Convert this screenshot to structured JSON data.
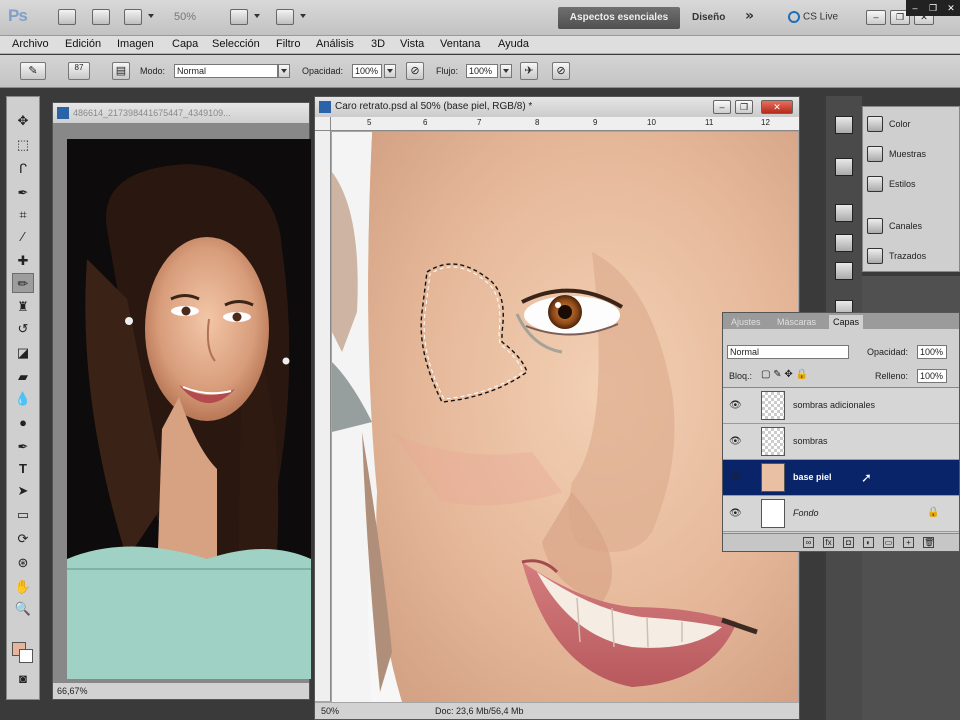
{
  "app": {
    "logo": "Ps",
    "zoom_display": "50%",
    "workspace_active": "Aspectos esenciales",
    "workspace_design": "Diseño",
    "workspace_more": "»",
    "cs_live": "CS Live",
    "window_controls": [
      "–",
      "❐",
      "✕"
    ]
  },
  "menu": [
    "Archivo",
    "Edición",
    "Imagen",
    "Capa",
    "Selección",
    "Filtro",
    "Análisis",
    "3D",
    "Vista",
    "Ventana",
    "Ayuda"
  ],
  "options": {
    "brush_size": "87",
    "mode_label": "Modo:",
    "mode_value": "Normal",
    "opacity_label": "Opacidad:",
    "opacity_value": "100%",
    "flow_label": "Flujo:",
    "flow_value": "100%"
  },
  "tools": [
    "move-tool",
    "marquee-tool",
    "lasso-tool",
    "quick-select-tool",
    "crop-tool",
    "eyedropper-tool",
    "healing-tool",
    "brush-tool",
    "stamp-tool",
    "history-brush-tool",
    "eraser-tool",
    "gradient-tool",
    "blur-tool",
    "dodge-tool",
    "pen-tool",
    "type-tool",
    "path-select-tool",
    "shape-tool",
    "3d-rotate-tool",
    "3d-camera-tool",
    "hand-tool",
    "zoom-tool"
  ],
  "colors": {
    "foreground": "#e7b59b",
    "background": "#ffffff",
    "accent": "#0a246a"
  },
  "doc_reference": {
    "title": "486614_217398441675447_4349109...",
    "zoom": "66,67%"
  },
  "doc_painting": {
    "title": "Caro retrato.psd al 50% (base piel, RGB/8) *",
    "ruler_marks": [
      "5",
      "6",
      "7",
      "8",
      "9",
      "10",
      "11",
      "12"
    ],
    "status_zoom": "50%",
    "status_doc": "Doc: 23,6 Mb/56,4 Mb"
  },
  "right_panels": [
    {
      "icon": "color-icon",
      "label": "Color"
    },
    {
      "icon": "swatches-icon",
      "label": "Muestras"
    },
    {
      "icon": "styles-icon",
      "label": "Estilos"
    },
    {
      "icon": "channels-icon",
      "label": "Canales"
    },
    {
      "icon": "paths-icon",
      "label": "Trazados"
    }
  ],
  "layers_panel": {
    "tabs": [
      "Ajustes",
      "Máscaras",
      "Capas"
    ],
    "blend_mode": "Normal",
    "opacity_label": "Opacidad:",
    "opacity_value": "100%",
    "lock_label": "Bloq.:",
    "fill_label": "Relleno:",
    "fill_value": "100%",
    "layers": [
      {
        "name": "sombras adicionales",
        "active": false
      },
      {
        "name": "sombras",
        "active": false
      },
      {
        "name": "base piel",
        "active": true
      },
      {
        "name": "Fondo",
        "active": false
      }
    ]
  }
}
